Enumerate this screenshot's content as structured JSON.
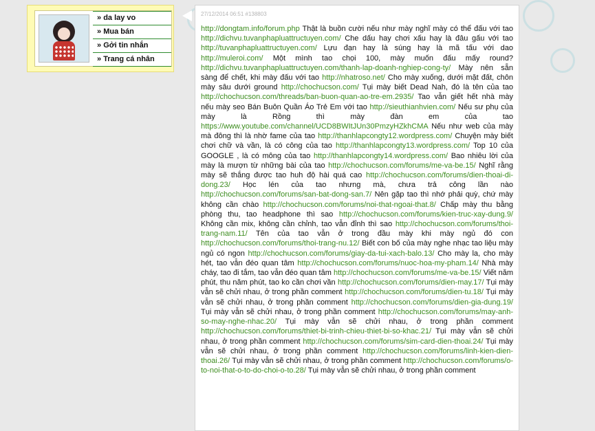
{
  "user_menu": {
    "items": [
      "da lay vo",
      "Mua bán",
      "Gởi tin nhắn",
      "Trang cá nhân"
    ]
  },
  "post": {
    "meta": "27/12/2014 06:51 #138803",
    "segments": [
      {
        "link": "http://dongtam.info/forum.php"
      },
      {
        "text": " Thật là buồn cười nếu như mày nghĩ mày có thể đấu với tao "
      },
      {
        "link": "http://dichvu.tuvanphapluattructuyen.com/"
      },
      {
        "text": " Che dấu hay chơi xấu hay là đâu gấu với tao "
      },
      {
        "link": "http://tuvanphapluattructuyen.com/"
      },
      {
        "text": " Lựu đạn hay là súng hay là mã tấu với dao "
      },
      {
        "link": "http://muleroi.com/"
      },
      {
        "text": " Một mình tao chọi 100, mày muốn đấu mấy round? "
      },
      {
        "link": "http://dichvu.tuvanphapluattructuyen.com/thanh-lap-doanh-nghiep-cong-ty/"
      },
      {
        "text": " Mày nên sẵn sàng để chết, khi mày đấu với tao "
      },
      {
        "link": "http://nhatroso.net/"
      },
      {
        "text": " Cho mày xuống, dưới mặt đất, chôn mày sâu dưới ground "
      },
      {
        "link": "http://chochucson.com/"
      },
      {
        "text": " Tụi mày biết Dead Nah, đó là tên của tao "
      },
      {
        "link": "http://chochucson.com/threads/ban-buon-quan-ao-tre-em.2935/"
      },
      {
        "text": " Tao vẫn giết hết nhà mày nếu mày seo Bán Buôn Quần Áo Trẻ Em với tao "
      },
      {
        "link": "http://sieuthianhvien.com/"
      },
      {
        "text": " Nếu sư phụ của mày là Rồng thì mày đàn em của tao "
      },
      {
        "link": "https://www.youtube.com/channel/UCD8BWItJUn30PmzyHZkhCMA"
      },
      {
        "text": " Nếu như web của mày mà đông thì là nhờ fame của tao "
      },
      {
        "link": "http://thanhlapcongty12.wordpress.com/"
      },
      {
        "text": " Chuyện mày biết chơi chữ và vần, là có công của tao "
      },
      {
        "link": "http://thanhlapcongty13.wordpress.com/"
      },
      {
        "text": " Top 10 của GOOGLE , là có mông của tao "
      },
      {
        "link": "http://thanhlapcongty14.wordpress.com/"
      },
      {
        "text": " Bao nhiêu lời của mày là mượn từ những bài của tao "
      },
      {
        "link": "http://chochucson.com/forums/me-va-be.15/"
      },
      {
        "text": " Nghĩ rằng mày sẽ thắng được tao huh độ hài quá cao "
      },
      {
        "link": "http://chochucson.com/forums/dien-thoai-di-dong.23/"
      },
      {
        "text": " Học lén của tao nhưng mà, chưa trả công lần nào "
      },
      {
        "link": "http://chochucson.com/forums/san-bat-dong-san.7/"
      },
      {
        "text": " Nên gặp tao thì nhớ phải quỳ, chứ mày không cần chào "
      },
      {
        "link": "http://chochucson.com/forums/noi-that-ngoai-that.8/"
      },
      {
        "text": " Chấp mày thu bằng phòng thu, tao headphone thì sao "
      },
      {
        "link": "http://chochucson.com/forums/kien-truc-xay-dung.9/"
      },
      {
        "text": " Không cần mix, không cần chỉnh, tao vẫn đỉnh thì sao "
      },
      {
        "link": "http://chochucson.com/forums/thoi-trang-nam.11/"
      },
      {
        "text": " Tên của tao vẫn ở trong đầu mày khi mày ngủ đó con "
      },
      {
        "link": "http://chochucson.com/forums/thoi-trang-nu.12/"
      },
      {
        "text": " Biết con bố của mày nghe nhạc tao liệu mày ngủ có ngon "
      },
      {
        "link": "http://chochucson.com/forums/giay-da-tui-xach-balo.13/"
      },
      {
        "text": " Cho mày la, cho mày hét, tao vẫn đéo quan tâm "
      },
      {
        "link": "http://chochucson.com/forums/nuoc-hoa-my-pham.14/"
      },
      {
        "text": " Nhà mày cháy, tao đi tắm, tao vẫn đéo quan tâm "
      },
      {
        "link": "http://chochucson.com/forums/me-va-be.15/"
      },
      {
        "text": " Viết năm phút, thu năm phút, tao ko cần chơi vần "
      },
      {
        "link": "http://chochucson.com/forums/dien-may.17/"
      },
      {
        "text": " Tụi mày vẫn sẽ chửi nhau, ở trong phần comment "
      },
      {
        "link": "http://chochucson.com/forums/dien-tu.18/"
      },
      {
        "text": " Tụi mày vẫn sẽ chửi nhau, ở trong phần comment "
      },
      {
        "link": "http://chochucson.com/forums/dien-gia-dung.19/"
      },
      {
        "text": " Tụi mày vẫn sẽ chửi nhau, ở trong phần comment "
      },
      {
        "link": "http://chochucson.com/forums/may-anh-so-may-nghe-nhac.20/"
      },
      {
        "text": " Tụi mày vẫn sẽ chửi nhau, ở trong phần comment "
      },
      {
        "link": "http://chochucson.com/forums/thiet-bi-trinh-chieu-thiet-bi-so-khac.21/"
      },
      {
        "text": " Tụi mày vẫn sẽ chửi nhau, ở trong phần comment "
      },
      {
        "link": "http://chochucson.com/forums/sim-card-dien-thoai.24/"
      },
      {
        "text": " Tụi mày vẫn sẽ chửi nhau, ở trong phần comment "
      },
      {
        "link": "http://chochucson.com/forums/linh-kien-dien-thoai.26/"
      },
      {
        "text": " Tụi mày vẫn sẽ chửi nhau, ở trong phần comment "
      },
      {
        "link": "http://chochucson.com/forums/o-to-noi-that-o-to-do-choi-o-to.28/"
      },
      {
        "text": " Tụi mày vẫn sẽ chửi nhau, ở trong phần comment"
      }
    ]
  },
  "colors": {
    "link": "#3c8c1e",
    "card_bg": "#fffbb5",
    "menu_border": "#2d8b2d"
  }
}
